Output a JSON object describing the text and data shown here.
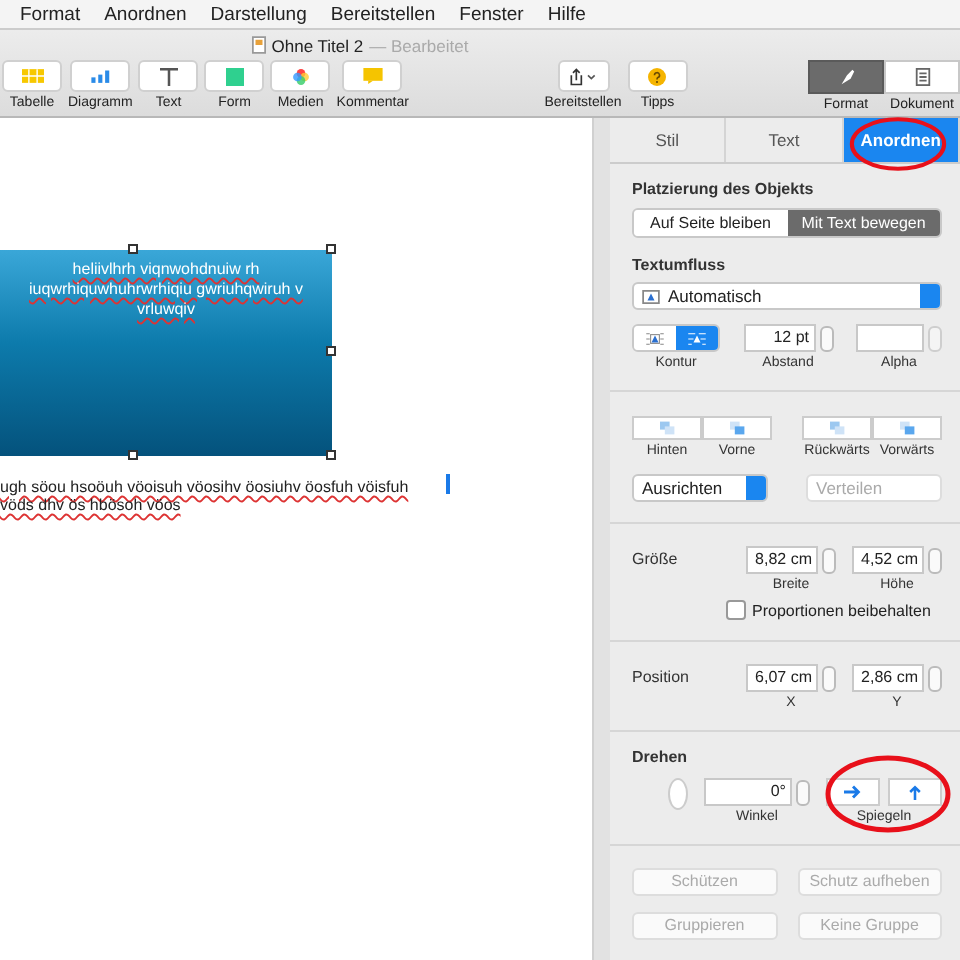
{
  "menu_bar": [
    "Format",
    "Anordnen",
    "Darstellung",
    "Bereitstellen",
    "Fenster",
    "Hilfe"
  ],
  "window": {
    "title": "Ohne Titel 2",
    "status": "— Bearbeitet"
  },
  "toolbar": {
    "items": [
      {
        "kind": "table",
        "label": "Tabelle"
      },
      {
        "kind": "chart",
        "label": "Diagramm"
      },
      {
        "kind": "text",
        "label": "Text"
      },
      {
        "kind": "shape",
        "label": "Form"
      },
      {
        "kind": "media",
        "label": "Medien"
      },
      {
        "kind": "comment",
        "label": "Kommentar"
      }
    ],
    "share": "Bereitstellen",
    "tips": "Tipps",
    "views": [
      {
        "kind": "format",
        "label": "Format",
        "selected": true
      },
      {
        "kind": "document",
        "label": "Dokument",
        "selected": false
      }
    ]
  },
  "document": {
    "shape_text": [
      "heliivlhrh viqnwohdnuiw rh",
      "iuqwrhiquwhuhrwrhiqiu gwriuhqwiruh v",
      "vrluwqiv"
    ],
    "body_text": [
      "ugh söou hsoöuh vöoisuh vöosihv öosiuhv öosfuh vöisfuh",
      "vöds dhv ös hbösoh vöos"
    ]
  },
  "sidebar": {
    "tabs": [
      {
        "label": "Stil",
        "selected": false
      },
      {
        "label": "Text",
        "selected": false
      },
      {
        "label": "Anordnen",
        "selected": true
      }
    ],
    "placement": {
      "heading": "Platzierung des Objekts",
      "options": [
        {
          "label": "Auf Seite bleiben",
          "selected": false
        },
        {
          "label": "Mit Text bewegen",
          "selected": true
        }
      ]
    },
    "text_wrap": {
      "heading": "Textumfluss",
      "value": "Automatisch",
      "fit": [
        {
          "kind": "box",
          "selected": false
        },
        {
          "kind": "contour",
          "selected": true
        }
      ],
      "fit_label": "Kontur",
      "spacing": "12 pt",
      "spacing_label": "Abstand",
      "alpha_label": "Alpha"
    },
    "layers": [
      {
        "kind": "back",
        "label": "Hinten"
      },
      {
        "kind": "front",
        "label": "Vorne"
      },
      {
        "kind": "backward",
        "label": "Rückwärts"
      },
      {
        "kind": "forward",
        "label": "Vorwärts"
      }
    ],
    "align": {
      "label": "Ausrichten",
      "disabled": false
    },
    "distribute": {
      "label": "Verteilen",
      "disabled": true
    },
    "size": {
      "heading": "Größe",
      "width": "8,82 cm",
      "width_label": "Breite",
      "height": "4,52 cm",
      "height_label": "Höhe",
      "constrain_label": "Proportionen beibehalten",
      "constrain": false
    },
    "position": {
      "heading": "Position",
      "x": "6,07 cm",
      "x_label": "X",
      "y": "2,86 cm",
      "y_label": "Y"
    },
    "rotate": {
      "heading": "Drehen",
      "angle": "0°",
      "angle_label": "Winkel",
      "flip_label": "Spiegeln"
    },
    "buttons": [
      {
        "label": "Schützen",
        "disabled": true
      },
      {
        "label": "Schutz aufheben",
        "disabled": true
      },
      {
        "label": "Gruppieren",
        "disabled": true
      },
      {
        "label": "Keine Gruppe",
        "disabled": true
      }
    ]
  }
}
